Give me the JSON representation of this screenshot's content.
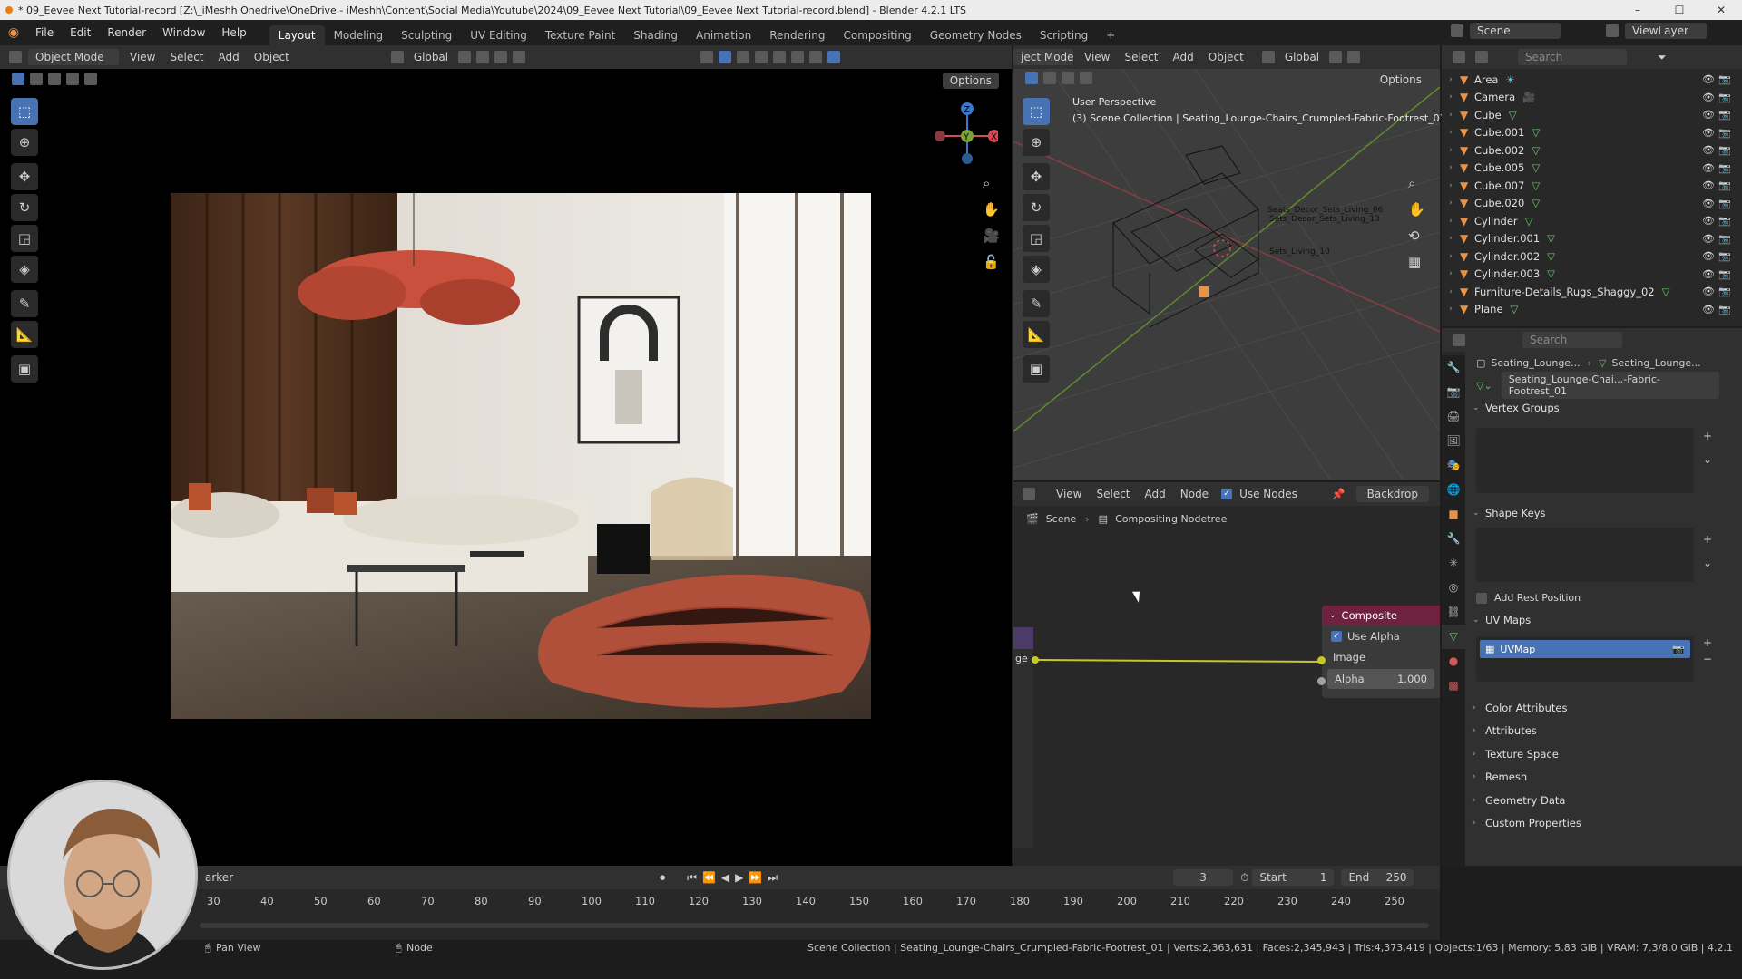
{
  "titlebar": {
    "text": "* 09_Eevee Next Tutorial-record [Z:\\_iMeshh Onedrive\\OneDrive - iMeshh\\Content\\Social Media\\Youtube\\2024\\09_Eevee Next Tutorial\\09_Eevee Next Tutorial-record.blend] - Blender 4.2.1 LTS",
    "min": "–",
    "max": "☐",
    "close": "✕"
  },
  "menu": {
    "items": [
      "File",
      "Edit",
      "Render",
      "Window",
      "Help"
    ],
    "tabs": [
      "Layout",
      "Modeling",
      "Sculpting",
      "UV Editing",
      "Texture Paint",
      "Shading",
      "Animation",
      "Rendering",
      "Compositing",
      "Geometry Nodes",
      "Scripting"
    ],
    "add": "+",
    "scene": "Scene",
    "viewlayer": "ViewLayer"
  },
  "viewport_left": {
    "mode": "Object Mode",
    "menus": [
      "View",
      "Select",
      "Add",
      "Object"
    ],
    "transform": "Global",
    "options": "Options"
  },
  "viewport_right": {
    "mode": "ject Mode",
    "menus": [
      "View",
      "Select",
      "Add",
      "Object"
    ],
    "transform": "Global",
    "options": "Options",
    "perspective": "User Perspective",
    "collection": "(3) Scene Collection | Seating_Lounge-Chairs_Crumpled-Fabric-Footrest_01",
    "labels": [
      "Seats_Decor_Sets_Living_06",
      "Sets_Decor_Sets_Living_13",
      "Sets_Living_10"
    ]
  },
  "node_editor": {
    "menus": [
      "View",
      "Select",
      "Add",
      "Node"
    ],
    "use_nodes": "Use Nodes",
    "backdrop": "Backdrop",
    "breadcrumb_scene": "Scene",
    "breadcrumb_tree": "Compositing Nodetree",
    "node_title": "Composite",
    "use_alpha": "Use Alpha",
    "image": "Image",
    "alpha_label": "Alpha",
    "alpha_value": "1.000",
    "left_socket": "ge"
  },
  "outliner": {
    "search": "Search",
    "items": [
      {
        "name": "Area",
        "icon": "light"
      },
      {
        "name": "Camera",
        "icon": "camera"
      },
      {
        "name": "Cube",
        "icon": "mesh"
      },
      {
        "name": "Cube.001",
        "icon": "mesh"
      },
      {
        "name": "Cube.002",
        "icon": "mesh"
      },
      {
        "name": "Cube.005",
        "icon": "mesh"
      },
      {
        "name": "Cube.007",
        "icon": "mesh"
      },
      {
        "name": "Cube.020",
        "icon": "mesh"
      },
      {
        "name": "Cylinder",
        "icon": "mesh"
      },
      {
        "name": "Cylinder.001",
        "icon": "mesh"
      },
      {
        "name": "Cylinder.002",
        "icon": "mesh"
      },
      {
        "name": "Cylinder.003",
        "icon": "mesh"
      },
      {
        "name": "Furniture-Details_Rugs_Shaggy_02",
        "icon": "mesh"
      },
      {
        "name": "Plane",
        "icon": "mesh"
      }
    ]
  },
  "properties": {
    "search": "Search",
    "crumb1": "Seating_Lounge...",
    "crumb2": "Seating_Lounge...",
    "mesh_name": "Seating_Lounge-Chai...-Fabric-Footrest_01",
    "vertex_groups": "Vertex Groups",
    "shape_keys": "Shape Keys",
    "add_rest": "Add Rest Position",
    "uv_maps": "UV Maps",
    "uvmap": "UVMap",
    "collapsed": [
      "Color Attributes",
      "Attributes",
      "Texture Space",
      "Remesh",
      "Geometry Data",
      "Custom Properties"
    ]
  },
  "timeline": {
    "marker": "arker",
    "frame": "3",
    "start_label": "Start",
    "start": "1",
    "end_label": "End",
    "end": "250",
    "ticks": [
      "30",
      "40",
      "50",
      "60",
      "70",
      "80",
      "90",
      "100",
      "110",
      "120",
      "130",
      "140",
      "150",
      "160",
      "170",
      "180",
      "190",
      "200",
      "210",
      "220",
      "230",
      "240",
      "250"
    ]
  },
  "statusbar": {
    "pan": "Pan View",
    "node": "Node",
    "info": "Scene Collection | Seating_Lounge-Chairs_Crumpled-Fabric-Footrest_01 | Verts:2,363,631 | Faces:2,345,943 | Tris:4,373,419 | Objects:1/63 | Memory: 5.83 GiB | VRAM: 7.3/8.0 GiB | 4.2.1"
  },
  "colors": {
    "accent": "#4772b3",
    "orange": "#e8934a",
    "panel": "#303030",
    "bg": "#1d1d1d"
  }
}
